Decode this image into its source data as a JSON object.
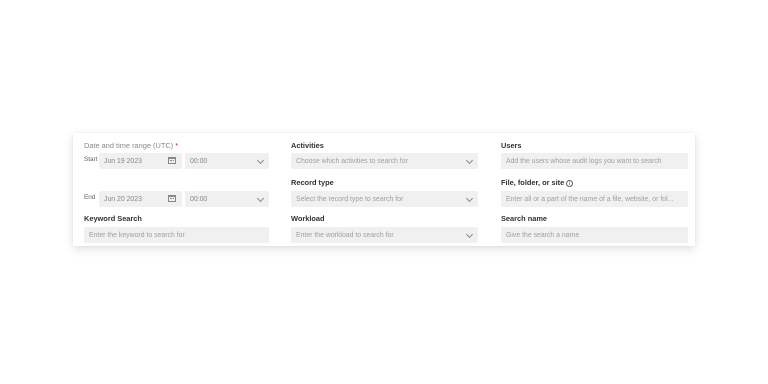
{
  "date_range": {
    "label": "Date and time range (UTC)",
    "required_mark": "*",
    "start": {
      "label": "Start",
      "date": "Jun 19 2023",
      "time": "00:00"
    },
    "end": {
      "label": "End",
      "date": "Jun 20 2023",
      "time": "00:00"
    }
  },
  "activities": {
    "label": "Activities",
    "placeholder": "Choose which activities to search for"
  },
  "users": {
    "label": "Users",
    "placeholder": "Add the users whose audit logs you want to search"
  },
  "record_type": {
    "label": "Record type",
    "placeholder": "Select the record type to search for"
  },
  "file_folder_site": {
    "label": "File, folder, or site",
    "info_icon": "info-icon",
    "placeholder": "Enter all or a part of the name of a file, website, or fol..."
  },
  "keyword_search": {
    "label": "Keyword Search",
    "placeholder": "Enter the keyword to search for"
  },
  "workload": {
    "label": "Workload",
    "placeholder": "Enter the workload to search for"
  },
  "search_name": {
    "label": "Search name",
    "placeholder": "Give the search a name"
  },
  "icons": {
    "calendar": "calendar-icon",
    "dropdown": "chevron-down-icon"
  }
}
